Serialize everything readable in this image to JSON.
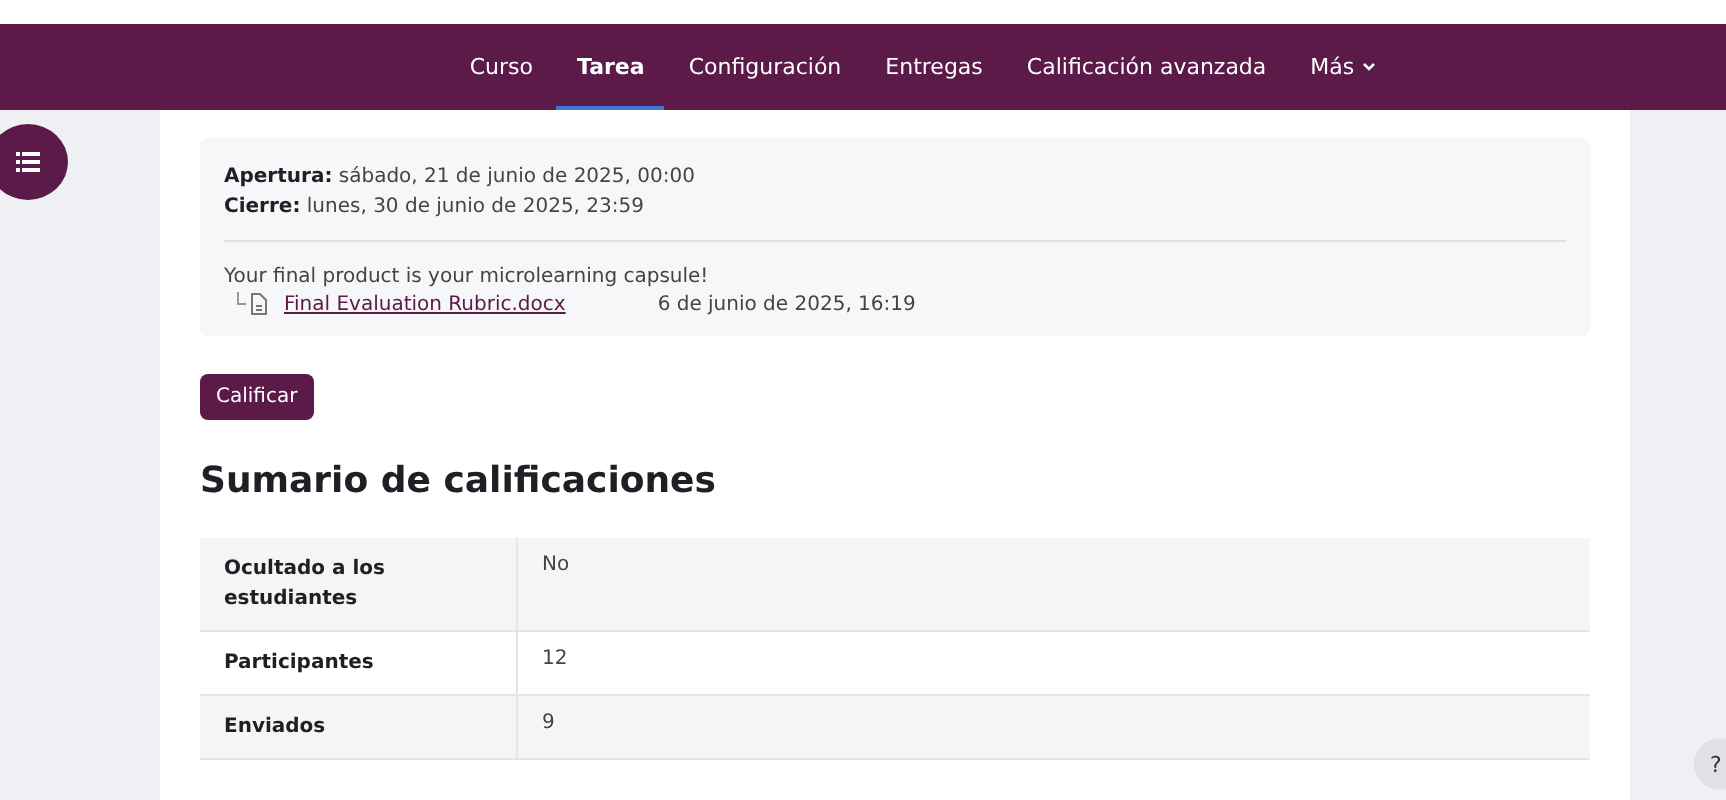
{
  "nav": {
    "tabs": [
      {
        "label": "Curso",
        "selected": false
      },
      {
        "label": "Tarea",
        "selected": true
      },
      {
        "label": "Configuración",
        "selected": false
      },
      {
        "label": "Entregas",
        "selected": false
      },
      {
        "label": "Calificación avanzada",
        "selected": false
      }
    ],
    "more": {
      "label": "Más"
    }
  },
  "dates": [
    {
      "label": "Apertura:",
      "value": "sábado, 21 de junio de 2025, 00:00"
    },
    {
      "label": "Cierre:",
      "value": "lunes, 30 de junio de 2025, 23:59"
    }
  ],
  "description": "Your final product is your microlearning capsule!",
  "attachment": {
    "name": "Final Evaluation Rubric.docx",
    "date": "6 de junio de 2025, 16:19"
  },
  "grade_button": "Calificar",
  "summary": {
    "title": "Sumario de calificaciones",
    "rows": [
      {
        "label": "Ocultado a los estudiantes",
        "value": "No"
      },
      {
        "label": "Participantes",
        "value": "12"
      },
      {
        "label": "Enviados",
        "value": "9"
      }
    ]
  },
  "help": {
    "label": "?"
  }
}
